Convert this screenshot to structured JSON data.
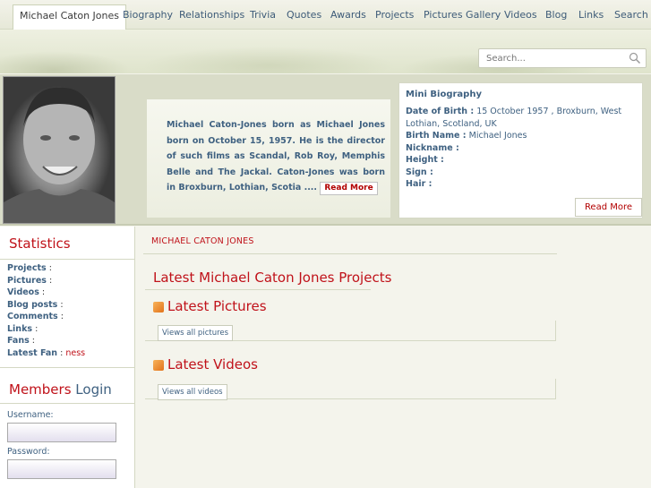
{
  "nav": {
    "items": [
      "Michael Caton Jones",
      "Biography",
      "Relationships",
      "Trivia",
      "Quotes",
      "Awards",
      "Projects",
      "Pictures Gallery",
      "Videos",
      "Blog",
      "Links",
      "Search"
    ]
  },
  "search": {
    "placeholder": "Search..."
  },
  "intro": {
    "text": "Michael Caton-Jones born as Michael Jones born on October 15, 1957. He is the director of such films as Scandal, Rob Roy, Memphis Belle and The Jackal. Caton-Jones was born in Broxburn, Lothian, Scotia ....",
    "read_more": "Read More"
  },
  "minibio": {
    "title": "Mini Biography",
    "dob_label": "Date of Birth :",
    "dob_value": "15 October 1957 , Broxburn, West Lothian, Scotland, UK",
    "birthname_label": "Birth Name :",
    "birthname_value": "Michael Jones",
    "nickname_label": "Nickname :",
    "height_label": "Height :",
    "sign_label": "Sign :",
    "hair_label": "Hair :",
    "read_more": "Read More"
  },
  "statistics": {
    "title": "Statistics",
    "projects_label": "Projects",
    "pictures_label": "Pictures",
    "videos_label": "Videos",
    "blog_label": "Blog posts",
    "comments_label": "Comments",
    "links_label": "Links",
    "fans_label": "Fans",
    "latest_fan_label": "Latest Fan",
    "latest_fan_value": "ness",
    "colon": ":"
  },
  "members": {
    "title_members": "Members",
    "title_login": "Login",
    "username_label": "Username:",
    "password_label": "Password:"
  },
  "main": {
    "breadcrumb": "MICHAEL CATON JONES",
    "projects_title": "Latest Michael Caton Jones Projects",
    "pictures_title": "Latest Pictures",
    "pictures_button": "Views all pictures",
    "videos_title": "Latest Videos",
    "videos_button": "Views all videos"
  },
  "colors": {
    "accent_red": "#c0121a",
    "link_blue": "#3f6181",
    "background": "#f4f4ec"
  }
}
